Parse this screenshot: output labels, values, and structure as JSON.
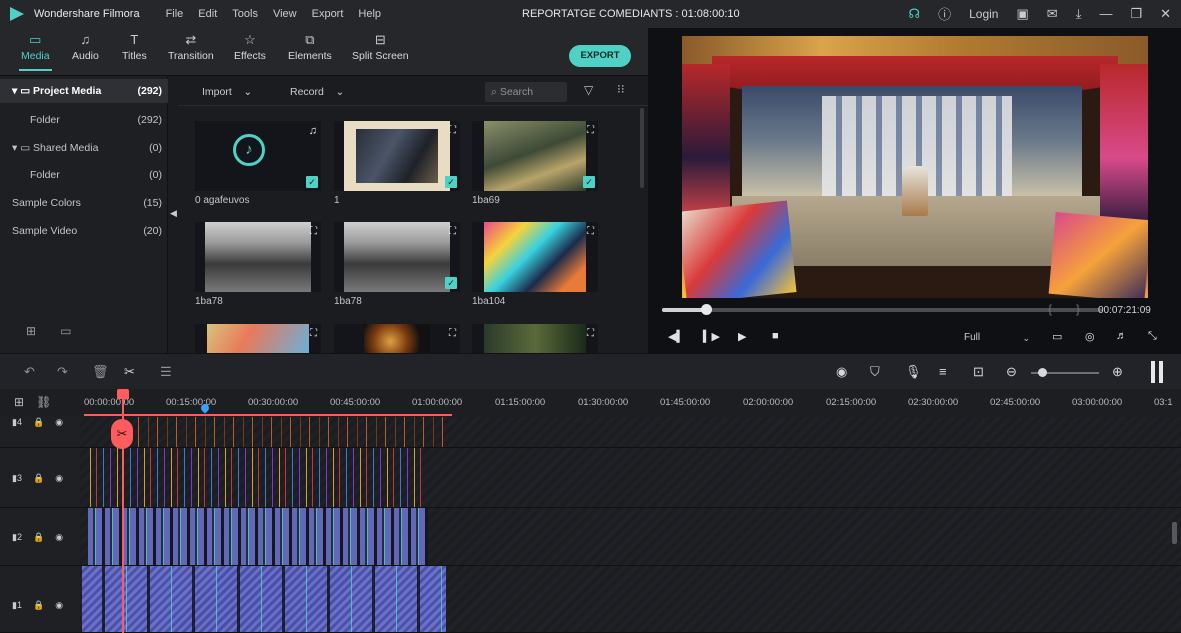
{
  "app": {
    "name": "Wondershare Filmora",
    "menu": [
      "File",
      "Edit",
      "Tools",
      "View",
      "Export",
      "Help"
    ],
    "project_title": "REPORTATGE COMEDIANTS : 01:08:00:10",
    "login": "Login"
  },
  "toolbar": {
    "tabs": [
      "Media",
      "Audio",
      "Titles",
      "Transition",
      "Effects",
      "Elements",
      "Split Screen"
    ],
    "active_tab": "Media",
    "export_label": "EXPORT"
  },
  "library": {
    "items": [
      {
        "name": "Project Media",
        "count": "(292)"
      },
      {
        "name": "Folder",
        "count": "(292)"
      },
      {
        "name": "Shared Media",
        "count": "(0)"
      },
      {
        "name": "Folder",
        "count": "(0)"
      },
      {
        "name": "Sample Colors",
        "count": "(15)"
      },
      {
        "name": "Sample Video",
        "count": "(20)"
      }
    ]
  },
  "media_bar": {
    "import_label": "Import",
    "record_label": "Record",
    "search_placeholder": "Search"
  },
  "media_items": [
    {
      "label": "0 agafeuvos"
    },
    {
      "label": "1"
    },
    {
      "label": "1ba69"
    },
    {
      "label": "1ba78"
    },
    {
      "label": "1ba78"
    },
    {
      "label": "1ba104"
    }
  ],
  "preview": {
    "timecode": "00:07:21:09",
    "quality": "Full",
    "progress": 0.1
  },
  "ruler": {
    "ticks": [
      "00:00:00:00",
      "00:15:00:00",
      "00:30:00:00",
      "00:45:00:00",
      "01:00:00:00",
      "01:15:00:00",
      "01:30:00:00",
      "01:45:00:00",
      "02:00:00:00",
      "02:15:00:00",
      "02:30:00:00",
      "02:45:00:00",
      "03:00:00:00",
      "03:1"
    ]
  },
  "tracks": [
    {
      "label": "4"
    },
    {
      "label": "3"
    },
    {
      "label": "2"
    },
    {
      "label": "1"
    }
  ],
  "colors": {
    "accent": "#4fd1c5",
    "playhead": "#ff5d5d"
  }
}
